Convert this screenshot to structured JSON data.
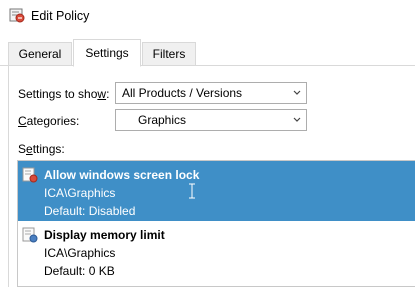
{
  "window": {
    "title": "Edit Policy",
    "icon": "policy-icon"
  },
  "tabs": [
    {
      "label": "General"
    },
    {
      "label": "Settings"
    },
    {
      "label": "Filters"
    }
  ],
  "settings_to_show": {
    "label_pre": "Settings to sho",
    "label_u": "w",
    "label_post": ":",
    "value": "All Products / Versions"
  },
  "categories": {
    "label_u": "C",
    "label_post": "ategories:",
    "value": "Graphics"
  },
  "settings_list": {
    "label_pre": "S",
    "label_u": "e",
    "label_post": "ttings:",
    "items": [
      {
        "name": "Allow windows screen lock",
        "path": "ICA\\Graphics",
        "default": "Default: Disabled",
        "selected": true
      },
      {
        "name": "Display memory limit",
        "path": "ICA\\Graphics",
        "default": "Default: 0  KB",
        "selected": false
      }
    ]
  },
  "colors": {
    "selection": "#3f8fc7",
    "border": "#adadad"
  }
}
